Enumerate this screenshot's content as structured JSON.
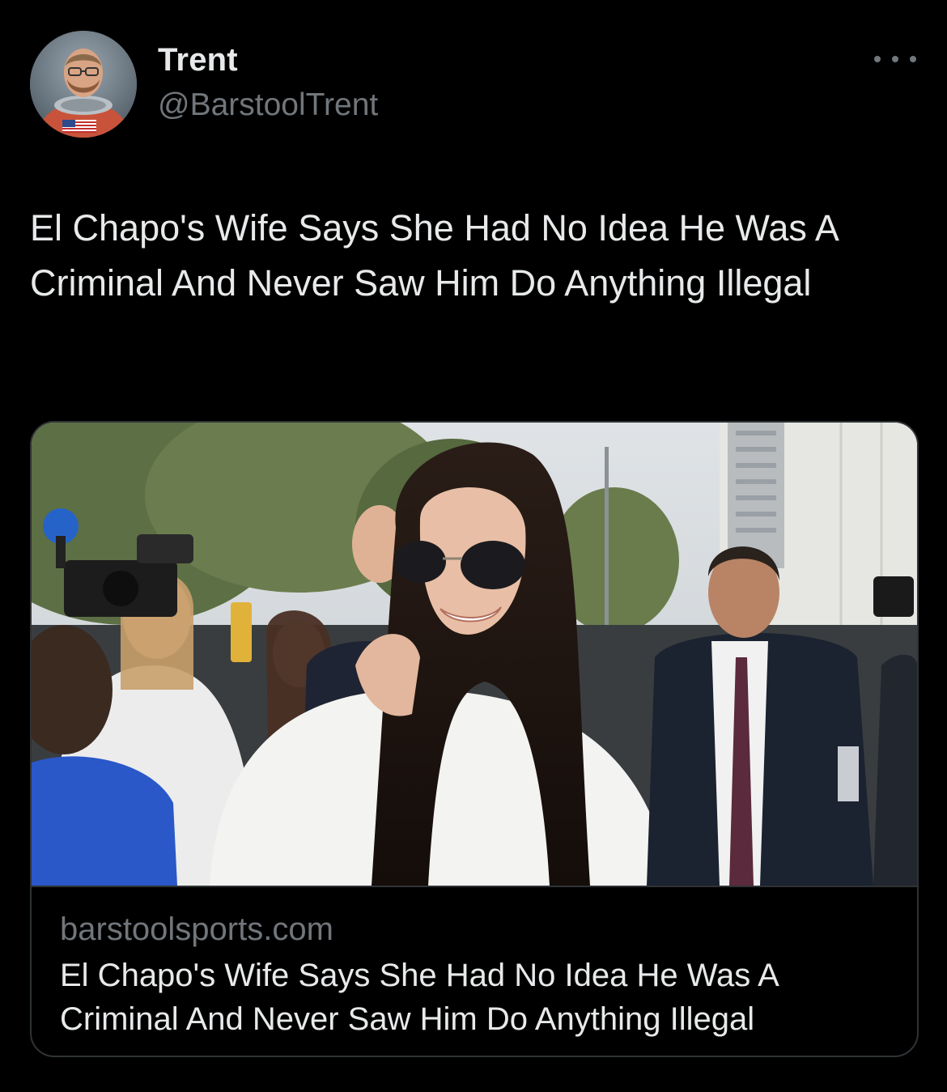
{
  "tweet": {
    "author": {
      "display_name": "Trent",
      "handle": "@BarstoolTrent"
    },
    "text": "El Chapo's Wife Says She Had No Idea He Was A Criminal And Never Saw Him Do Anything Illegal",
    "more_icon": "more-horizontal-icon"
  },
  "card": {
    "domain": "barstoolsports.com",
    "title": "El Chapo's Wife Says She Had No Idea He Was A Criminal And Never Saw Him Do Anything Illegal"
  },
  "colors": {
    "background": "#000000",
    "primary_text": "#e7e9ea",
    "secondary_text": "#71767b",
    "border": "#2f3336"
  }
}
